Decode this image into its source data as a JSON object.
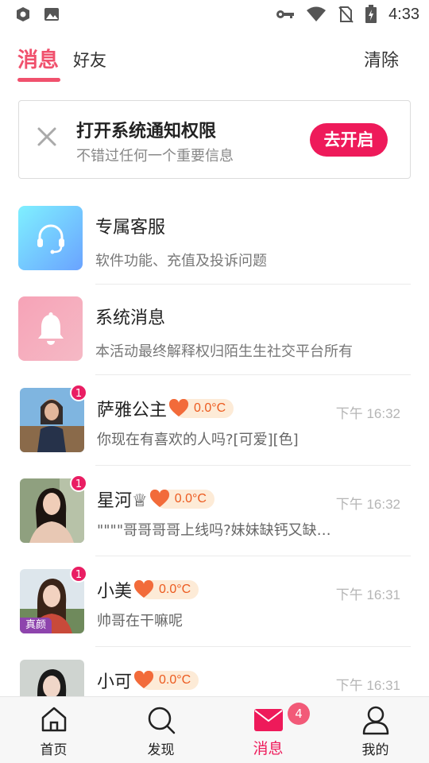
{
  "status_bar": {
    "time": "4:33",
    "icons": [
      "app-notification-icon",
      "image-icon",
      "key-icon",
      "wifi-icon",
      "no-sim-icon",
      "battery-charging-icon"
    ]
  },
  "tabs": {
    "messages": "消息",
    "friends": "好友",
    "clear": "清除"
  },
  "notification": {
    "title": "打开系统通知权限",
    "subtitle": "不错过任何一个重要信息",
    "button": "去开启"
  },
  "system_items": [
    {
      "title": "专属客服",
      "subtitle": "软件功能、充值及投诉问题",
      "icon": "headset-icon"
    },
    {
      "title": "系统消息",
      "subtitle": "本活动最终解释权归陌生生社交平台所有",
      "icon": "bell-icon"
    }
  ],
  "conversations": [
    {
      "name": "萨雅公主",
      "temperature": "0.0°C",
      "time": "下午 16:32",
      "preview": "你现在有喜欢的人吗?[可爱][色]",
      "unread": "1",
      "tag": ""
    },
    {
      "name": "星河♕",
      "temperature": "0.0°C",
      "time": "下午 16:32",
      "preview": "\"\"\"\"哥哥哥哥上线吗?妹妹缺钙又缺…",
      "unread": "1",
      "tag": ""
    },
    {
      "name": "小美",
      "temperature": "0.0°C",
      "time": "下午 16:31",
      "preview": "帅哥在干嘛呢",
      "unread": "1",
      "tag": "真颜"
    },
    {
      "name": "小可",
      "temperature": "0.0°C",
      "time": "下午 16:31",
      "preview": "",
      "unread": "",
      "tag": ""
    }
  ],
  "bottom_nav": {
    "home": "首页",
    "discover": "发现",
    "messages": "消息",
    "mine": "我的",
    "messages_badge": "4"
  },
  "colors": {
    "accent": "#ee1a5a",
    "tab_active": "#f0516d",
    "temp_text": "#ec5a1f",
    "temp_bg": "#fdebd7"
  }
}
